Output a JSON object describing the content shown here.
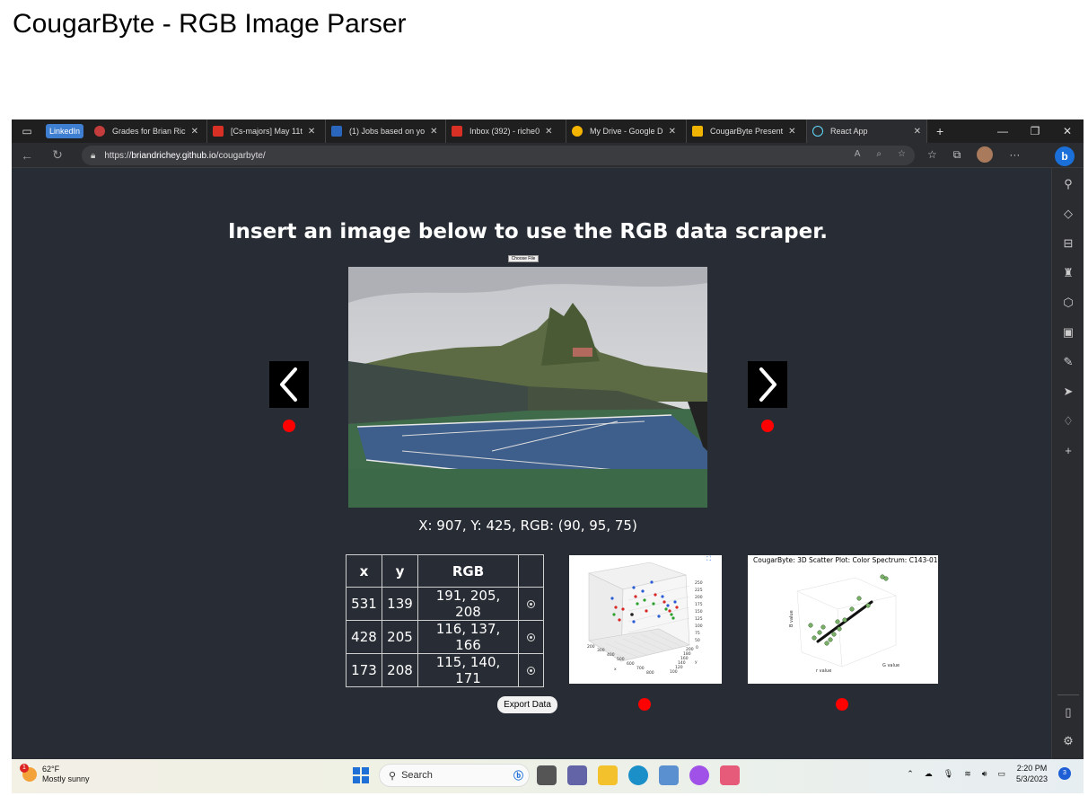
{
  "slide_title": "CougarByte - RGB Image Parser",
  "browser": {
    "pinned_tab": "LinkedIn",
    "tabs": [
      {
        "label": "Grades for Brian Ric",
        "color": "#c43c3c"
      },
      {
        "label": "[Cs-majors] May 11t",
        "color": "#d93025"
      },
      {
        "label": "(1) Jobs based on yo",
        "color": "#2a66bc"
      },
      {
        "label": "Inbox (392) - riche0",
        "color": "#d93025"
      },
      {
        "label": "My Drive - Google D",
        "color": "#f4b400"
      },
      {
        "label": "CougarByte Present",
        "color": "#f0b400"
      },
      {
        "label": "React App",
        "color": "#61dafb"
      }
    ],
    "url_prefix": "https://",
    "url_domain": "briandrichey.github.io",
    "url_path": "/cougarbyte/"
  },
  "page": {
    "heading": "Insert an image below to use the RGB data scraper.",
    "choose_file": "Choose File",
    "coords_text": "X: 907, Y: 425, RGB: (90, 95, 75)",
    "table": {
      "headers": [
        "x",
        "y",
        "RGB",
        ""
      ],
      "rows": [
        {
          "x": "531",
          "y": "139",
          "rgb": "191, 205, 208"
        },
        {
          "x": "428",
          "y": "205",
          "rgb": "116, 137, 166"
        },
        {
          "x": "173",
          "y": "208",
          "rgb": "115, 140, 171"
        }
      ]
    },
    "export_label": "Export Data",
    "plot2_title": "CougarByte: 3D Scatter Plot: Color Spectrum: C143-014",
    "plot1_ticks": {
      "z": [
        "250",
        "225",
        "200",
        "175",
        "150",
        "125",
        "100",
        "75",
        "50",
        "0"
      ],
      "y": [
        "200",
        "180",
        "160",
        "140",
        "120",
        "100"
      ],
      "x": [
        "200",
        "300",
        "400",
        "500",
        "600",
        "700",
        "800"
      ],
      "x_label": "x",
      "y_label": "y"
    },
    "plot2_labels": {
      "x": "r value",
      "y": "G value",
      "z": "B value"
    }
  },
  "taskbar": {
    "temp": "62°F",
    "weather": "Mostly sunny",
    "weather_badge": "1",
    "search": "Search",
    "time": "2:20 PM",
    "date": "5/3/2023",
    "notif_count": "3"
  }
}
